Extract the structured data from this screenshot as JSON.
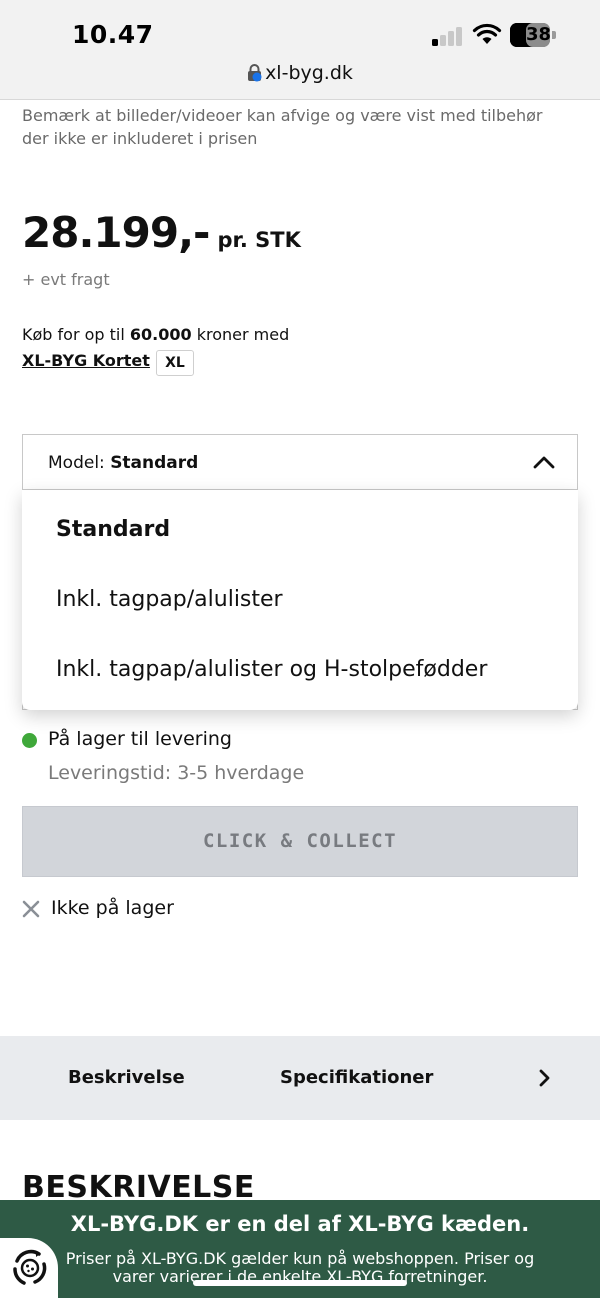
{
  "status_bar": {
    "time": "10.47",
    "battery": "38",
    "url": "xl-byg.dk"
  },
  "product": {
    "disclaimer": "Bemærk at billeder/videoer kan afvige og være vist med tilbehør der ikke er inkluderet i prisen",
    "price": "28.199,-",
    "price_unit": "pr. STK",
    "freight_note": "+ evt fragt",
    "credit_prefix": "Køb for op til",
    "credit_amount": "60.000",
    "credit_suffix": "kroner med",
    "card_link": "XL-BYG Kortet",
    "card_badge": "XL"
  },
  "model_select": {
    "label": "Model:",
    "selected": "Standard",
    "options": [
      "Standard",
      "Inkl. tagpap/alulister",
      "Inkl. tagpap/alulister og H-stolpefødder"
    ]
  },
  "stock": {
    "status": "På lager til levering",
    "delivery_time": "Leveringstid: 3-5 hverdage",
    "status_color": "#3fa83a",
    "click_collect_label": "CLICK & COLLECT",
    "store_status": "Ikke på lager"
  },
  "tabs": [
    "Beskrivelse",
    "Specifikationer"
  ],
  "section_title": "BESKRIVELSE",
  "banner": {
    "title": "XL-BYG.DK er en del af XL-BYG kæden.",
    "text": "Priser på XL-BYG.DK gælder kun på webshoppen. Priser og varer varierer i de enkelte XL-BYG forretninger.",
    "color": "#2e5a45"
  },
  "icons": {
    "lock": "lock-icon",
    "chevron_up": "chevron-up-icon",
    "close": "close-icon",
    "chevron_right": "chevron-right-icon",
    "cookie": "cookie-icon"
  }
}
